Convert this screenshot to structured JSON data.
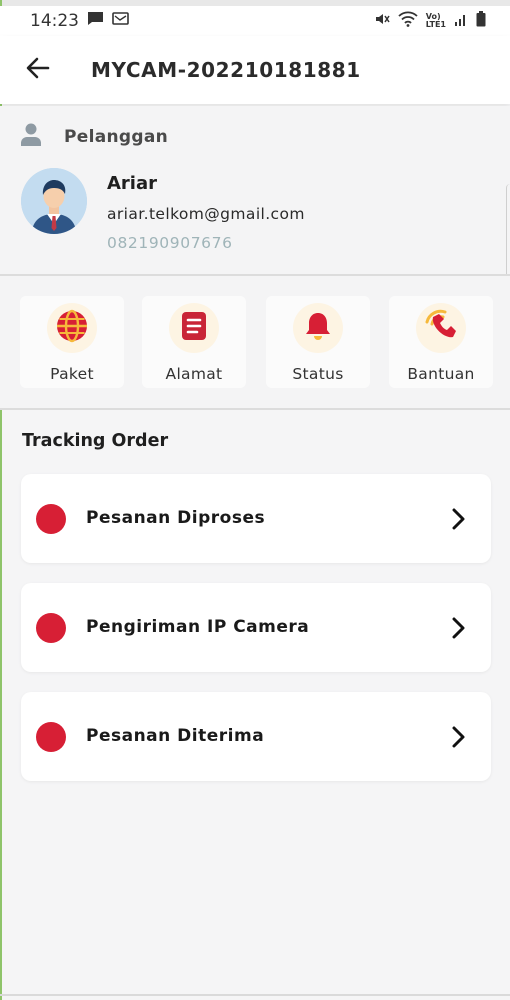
{
  "status_bar": {
    "time": "14:23",
    "icons": [
      "message-icon",
      "notification-icon",
      "mute-icon",
      "wifi-icon",
      "volte-icon",
      "signal-icon",
      "battery-icon"
    ],
    "volte_text_top": "Vo)",
    "volte_text_bottom": "LTE1"
  },
  "app_bar": {
    "back_icon": "arrow-left-icon",
    "title": "MYCAM-202210181881"
  },
  "customer": {
    "section_label": "Pelanggan",
    "section_icon": "person-icon",
    "name": "Ariar",
    "email": "ariar.telkom@gmail.com",
    "phone": "082190907676"
  },
  "menu": {
    "items": [
      {
        "label": "Paket",
        "icon": "globe-icon"
      },
      {
        "label": "Alamat",
        "icon": "document-icon"
      },
      {
        "label": "Status",
        "icon": "bell-icon"
      },
      {
        "label": "Bantuan",
        "icon": "phone-call-icon"
      }
    ]
  },
  "tracking": {
    "title": "Tracking Order",
    "steps": [
      {
        "label": "Pesanan Diproses"
      },
      {
        "label": "Pengiriman IP Camera"
      },
      {
        "label": "Pesanan Diterima"
      }
    ]
  },
  "colors": {
    "accent_red": "#d71f35",
    "icon_bg": "#fdf4e3",
    "phone_text": "#9fb4b8"
  }
}
